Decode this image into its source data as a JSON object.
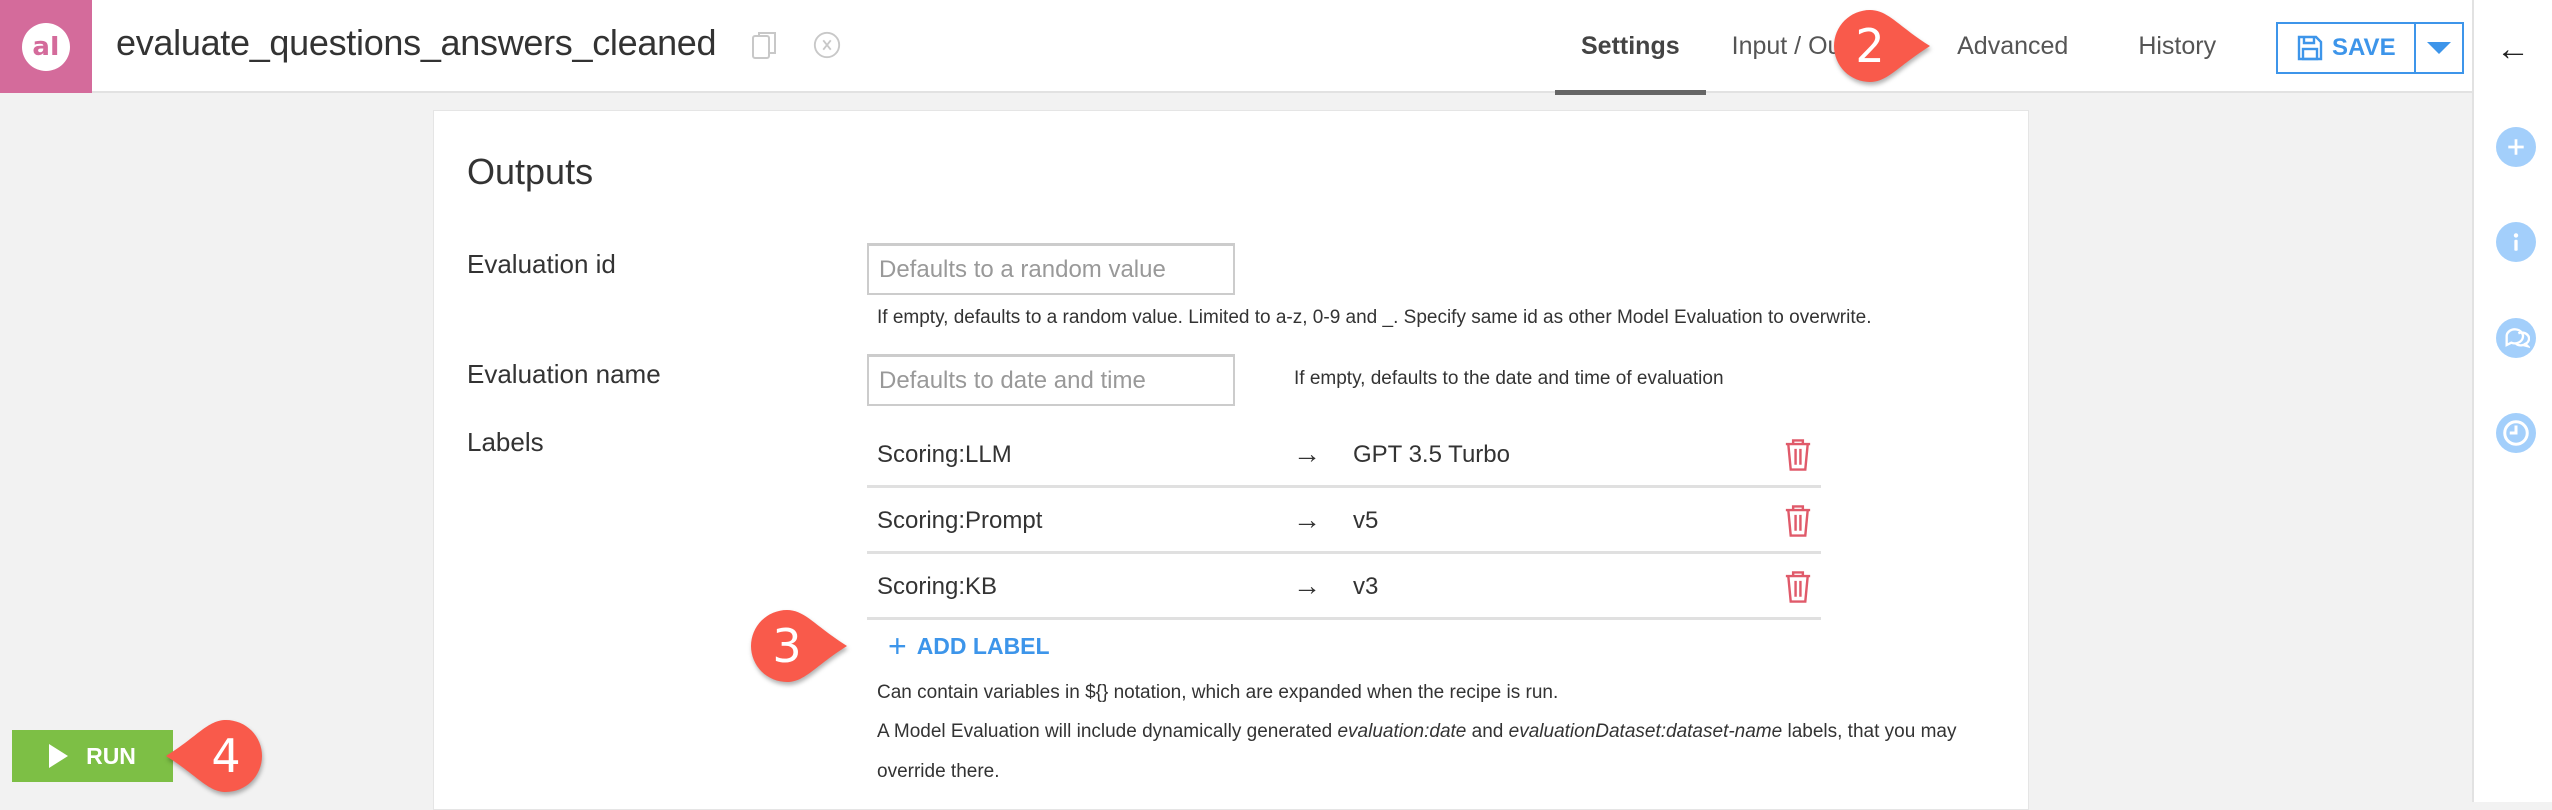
{
  "header": {
    "recipe_title": "evaluate_questions_answers_cleaned",
    "logo_text": "aI",
    "tabs": [
      {
        "label": "Settings",
        "active": true
      },
      {
        "label": "Input / Output",
        "active": false
      },
      {
        "label": "Advanced",
        "active": false
      },
      {
        "label": "History",
        "active": false
      }
    ],
    "save_label": "SAVE"
  },
  "outputs": {
    "section_title": "Outputs",
    "evaluation_id": {
      "label": "Evaluation id",
      "value": "",
      "placeholder": "Defaults to a random value",
      "help": "If empty, defaults to a random value. Limited to a-z, 0-9 and _. Specify same id as other Model Evaluation to overwrite."
    },
    "evaluation_name": {
      "label": "Evaluation name",
      "value": "",
      "placeholder": "Defaults to date and time",
      "help": "If empty, defaults to the date and time of evaluation"
    },
    "labels": {
      "label": "Labels",
      "arrow": "→",
      "rows": [
        {
          "key": "Scoring:LLM",
          "value": "GPT 3.5 Turbo"
        },
        {
          "key": "Scoring:Prompt",
          "value": "v5"
        },
        {
          "key": "Scoring:KB",
          "value": "v3"
        }
      ],
      "add_label": "ADD LABEL",
      "help_1": "Can contain variables in ${} notation, which are expanded when the recipe is run.",
      "help_2_a": "A Model Evaluation will include dynamically generated ",
      "help_2_b": "evaluation:date",
      "help_2_c": " and ",
      "help_2_d": "evaluationDataset:dataset-name",
      "help_2_e": " labels, that you may",
      "help_3": "override there."
    }
  },
  "run": {
    "label": "RUN"
  },
  "callouts": [
    {
      "number": "2",
      "target": "Advanced tab"
    },
    {
      "number": "3",
      "target": "Add label"
    },
    {
      "number": "4",
      "target": "Run button"
    }
  ],
  "colors": {
    "brand": "#d46b9b",
    "accent": "#3d95ea",
    "run": "#7dbf45",
    "delete": "#e05a6a",
    "callout": "#f95a4b"
  }
}
